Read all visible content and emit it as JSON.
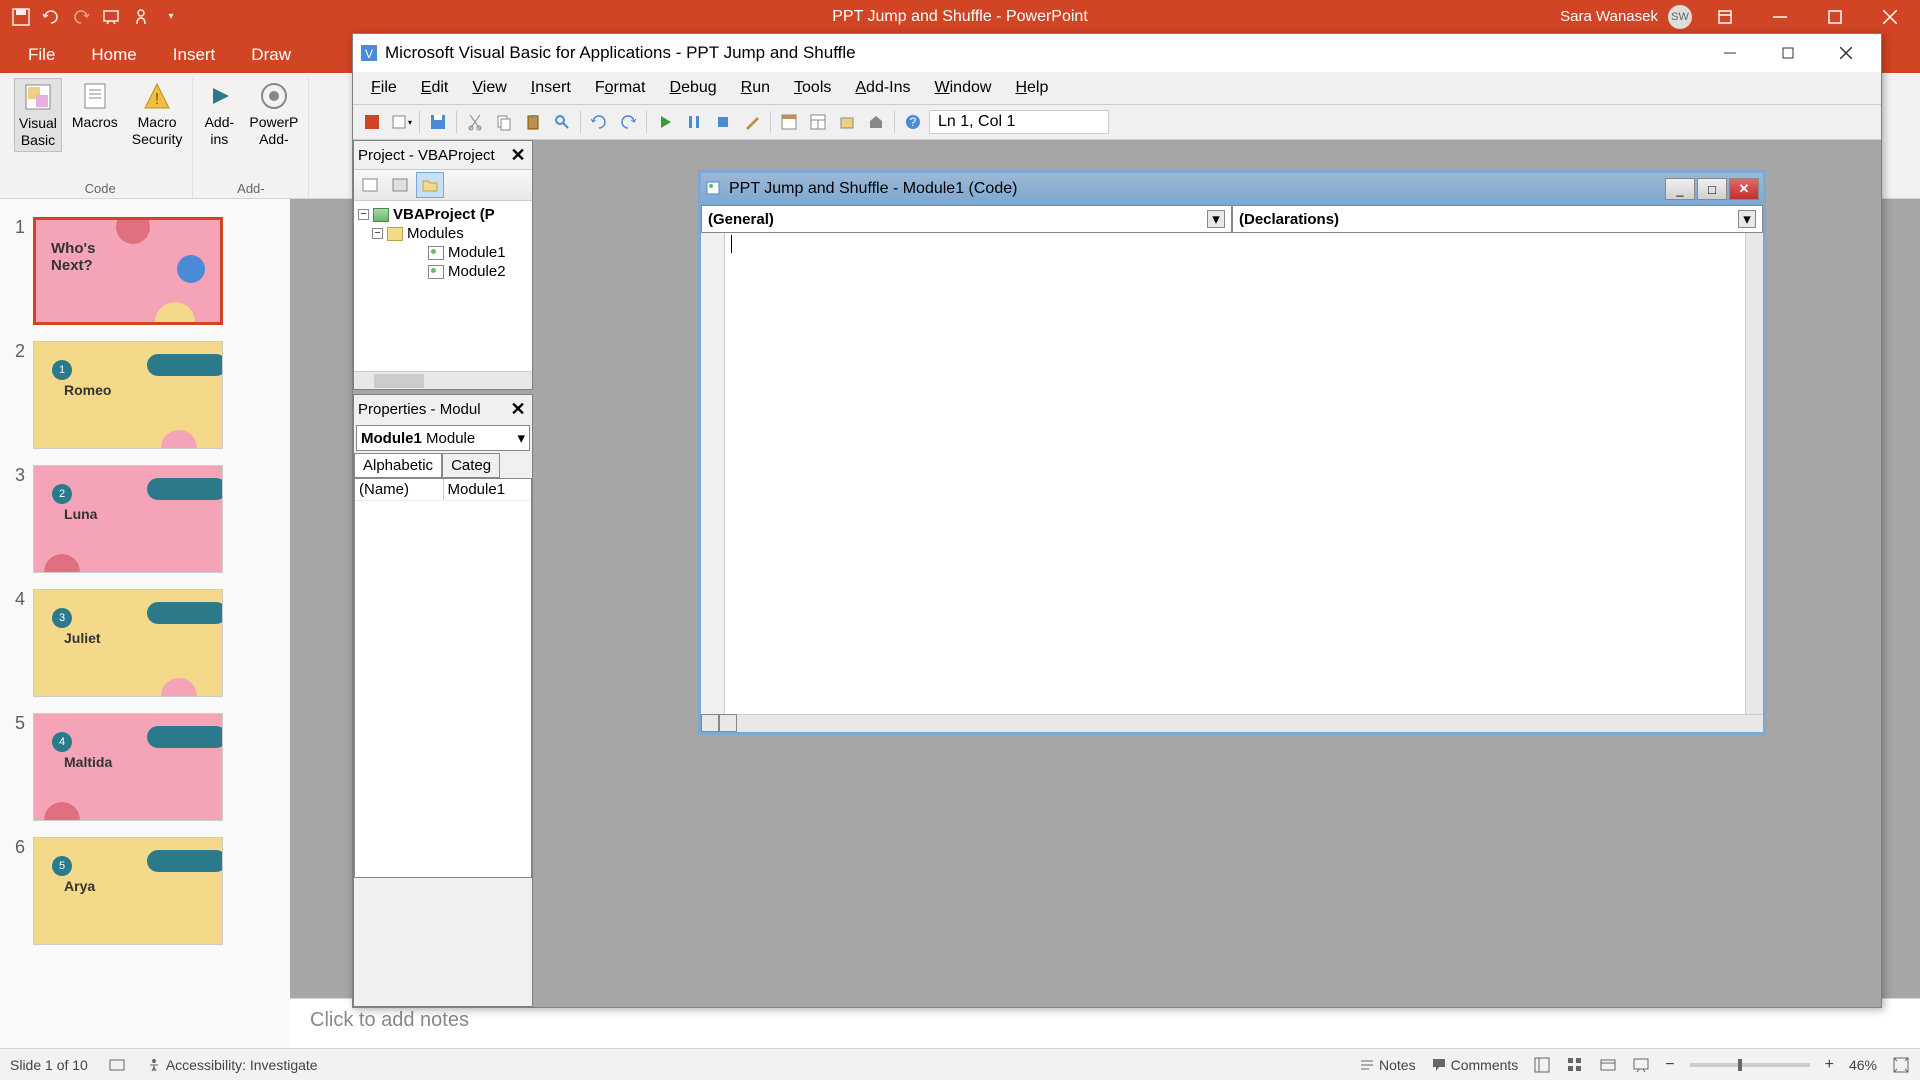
{
  "pp_titlebar": {
    "title": "PPT Jump and Shuffle  -  PowerPoint",
    "user": "Sara Wanasek",
    "user_initials": "SW"
  },
  "pp_tabs": [
    "File",
    "Home",
    "Insert",
    "Draw"
  ],
  "ribbon": {
    "visual_basic": "Visual\nBasic",
    "macros": "Macros",
    "macro_security": "Macro\nSecurity",
    "addins": "Add-\nins",
    "powerpoint_addins": "PowerP\nAdd-",
    "com_addins": "Add-",
    "group_code": "Code"
  },
  "slides": [
    {
      "num": "1",
      "bg": "pink",
      "title": "Who's\nNext?",
      "selected": true
    },
    {
      "num": "2",
      "bg": "cream",
      "title": "Romeo",
      "badge": "1"
    },
    {
      "num": "3",
      "bg": "pink",
      "title": "Luna",
      "badge": "2"
    },
    {
      "num": "4",
      "bg": "cream",
      "title": "Juliet",
      "badge": "3"
    },
    {
      "num": "5",
      "bg": "pink",
      "title": "Maltida",
      "badge": "4"
    },
    {
      "num": "6",
      "bg": "cream",
      "title": "Arya",
      "badge": "5"
    }
  ],
  "notes_placeholder": "Click to add notes",
  "statusbar": {
    "slide_info": "Slide 1 of 10",
    "accessibility": "Accessibility: Investigate",
    "notes": "Notes",
    "comments": "Comments",
    "zoom": "46%"
  },
  "vba": {
    "title": "Microsoft Visual Basic for Applications - PPT Jump and Shuffle",
    "menus": [
      "File",
      "Edit",
      "View",
      "Insert",
      "Format",
      "Debug",
      "Run",
      "Tools",
      "Add-Ins",
      "Window",
      "Help"
    ],
    "cursor_pos": "Ln 1, Col 1",
    "project_panel_title": "Project - VBAProject",
    "tree": {
      "root": "VBAProject (P",
      "folder": "Modules",
      "modules": [
        "Module1",
        "Module2"
      ]
    },
    "props_panel_title": "Properties - Modul",
    "props_combo_name": "Module1",
    "props_combo_type": "Module",
    "props_tabs": [
      "Alphabetic",
      "Categ"
    ],
    "props_row_name": "(Name)",
    "props_row_value": "Module1",
    "code_window_title": "PPT Jump and Shuffle - Module1 (Code)",
    "code_dropdown_left": "(General)",
    "code_dropdown_right": "(Declarations)"
  }
}
